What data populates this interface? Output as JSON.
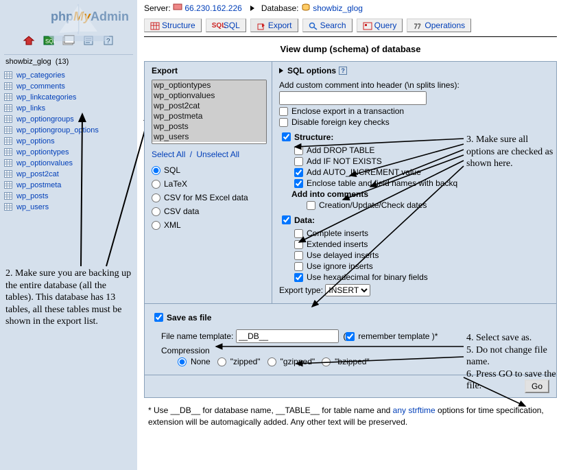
{
  "logo": {
    "p1": "php",
    "p2": "My",
    "p3": "Admin"
  },
  "crumbs": {
    "server_label": "Server:",
    "server": "66.230.162.226",
    "database_label": "Database:",
    "database": "showbiz_glog"
  },
  "tabs": {
    "structure": "Structure",
    "sql": "SQL",
    "export": "Export",
    "search": "Search",
    "query": "Query",
    "operations": "Operations"
  },
  "dump_title": "View dump (schema) of database",
  "sidebar": {
    "db_name": "showbiz_glog",
    "table_count": "(13)",
    "tables": [
      "wp_categories",
      "wp_comments",
      "wp_linkcategories",
      "wp_links",
      "wp_optiongroups",
      "wp_optiongroup_options",
      "wp_options",
      "wp_optiontypes",
      "wp_optionvalues",
      "wp_post2cat",
      "wp_postmeta",
      "wp_posts",
      "wp_users"
    ]
  },
  "export": {
    "title": "Export",
    "select_list": [
      "wp_optiontypes",
      "wp_optionvalues",
      "wp_post2cat",
      "wp_postmeta",
      "wp_posts",
      "wp_users"
    ],
    "select_all": "Select All",
    "unselect_all": "Unselect All",
    "formats": {
      "sql": "SQL",
      "latex": "LaTeX",
      "csv_excel": "CSV for MS Excel data",
      "csv": "CSV data",
      "xml": "XML"
    }
  },
  "sql_options": {
    "title": "SQL options",
    "custom_comment_label": "Add custom comment into header (\\n splits lines):",
    "enclose_tx": "Enclose export in a transaction",
    "disable_fk": "Disable foreign key checks",
    "structure_title": "Structure:",
    "drop_table": "Add DROP TABLE",
    "if_not_exists": "Add IF NOT EXISTS",
    "auto_inc": "Add AUTO_INCREMENT value",
    "backquotes": "Enclose table and field names with backq",
    "add_into_comments": "Add into comments",
    "dates": "Creation/Update/Check dates",
    "data_title": "Data:",
    "complete": "Complete inserts",
    "extended": "Extended inserts",
    "delayed": "Use delayed inserts",
    "ignore": "Use ignore inserts",
    "hex": "Use hexadecimal for binary fields",
    "export_type_label": "Export type:",
    "export_type": "INSERT"
  },
  "save": {
    "title": "Save as file",
    "template_label": "File name template:",
    "template_value": "__DB__",
    "remember": "remember template )*",
    "compression_label": "Compression",
    "none": "None",
    "zipped": "\"zipped\"",
    "gzipped": "\"gzipped\"",
    "bzipped": "\"bzipped\""
  },
  "go_label": "Go",
  "footnote": {
    "pre": "* Use __DB__ for database name, __TABLE__ for table name and ",
    "link": "any strftime",
    "post": " options for time specification, extension will be automagically added. Any other text will be preserved."
  },
  "annotations": {
    "note2": "2.  Make sure you are backing up the entire database (all the tables).  This  database has 13 tables, all these tables must be shown in the export list.",
    "note3": "3. Make sure all options are checked as shown here.",
    "note456": "4. Select save as.\n5. Do not change file name.\n6. Press GO to save the file."
  }
}
